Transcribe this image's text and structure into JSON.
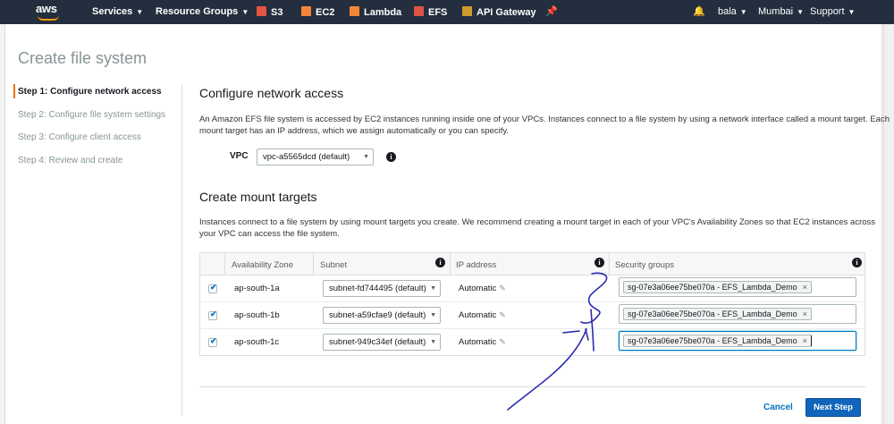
{
  "nav": {
    "logo": "aws",
    "services": "Services",
    "resource_groups": "Resource Groups",
    "shortcuts": [
      {
        "label": "S3",
        "color": "#e25444"
      },
      {
        "label": "EC2",
        "color": "#f58536"
      },
      {
        "label": "Lambda",
        "color": "#f58536"
      },
      {
        "label": "EFS",
        "color": "#e05243"
      },
      {
        "label": "API Gateway",
        "color": "#cf9b2f"
      }
    ],
    "user": "bala",
    "region": "Mumbai",
    "support": "Support"
  },
  "page_title": "Create file system",
  "steps": [
    "Step 1: Configure network access",
    "Step 2: Configure file system settings",
    "Step 3: Configure client access",
    "Step 4: Review and create"
  ],
  "network": {
    "heading": "Configure network access",
    "description_line1": "An Amazon EFS file system is accessed by EC2 instances running inside one of your VPCs. Instances connect to a file system by using a network interface called a mount target. Each",
    "description_line2": "mount target has an IP address, which we assign automatically or you can specify.",
    "vpc_label": "VPC",
    "vpc_value": "vpc-a5565dcd (default)"
  },
  "mount_targets": {
    "heading": "Create mount targets",
    "description_line1": "Instances connect to a file system by using mount targets you create. We recommend creating a mount target in each of your VPC's Availability Zones so that EC2 instances across",
    "description_line2": "your VPC can access the file system.",
    "columns": [
      "Availability Zone",
      "Subnet",
      "IP address",
      "Security groups"
    ],
    "rows": [
      {
        "zone": "ap-south-1a",
        "subnet": "subnet-fd744495 (default)",
        "ip": "Automatic",
        "sg": "sg-07e3a06ee75be070a - EFS_Lambda_Demo"
      },
      {
        "zone": "ap-south-1b",
        "subnet": "subnet-a59cfae9 (default)",
        "ip": "Automatic",
        "sg": "sg-07e3a06ee75be070a - EFS_Lambda_Demo"
      },
      {
        "zone": "ap-south-1c",
        "subnet": "subnet-949c34ef (default)",
        "ip": "Automatic",
        "sg": "sg-07e3a06ee75be070a - EFS_Lambda_Demo"
      }
    ]
  },
  "actions": {
    "cancel": "Cancel",
    "next": "Next Step"
  }
}
